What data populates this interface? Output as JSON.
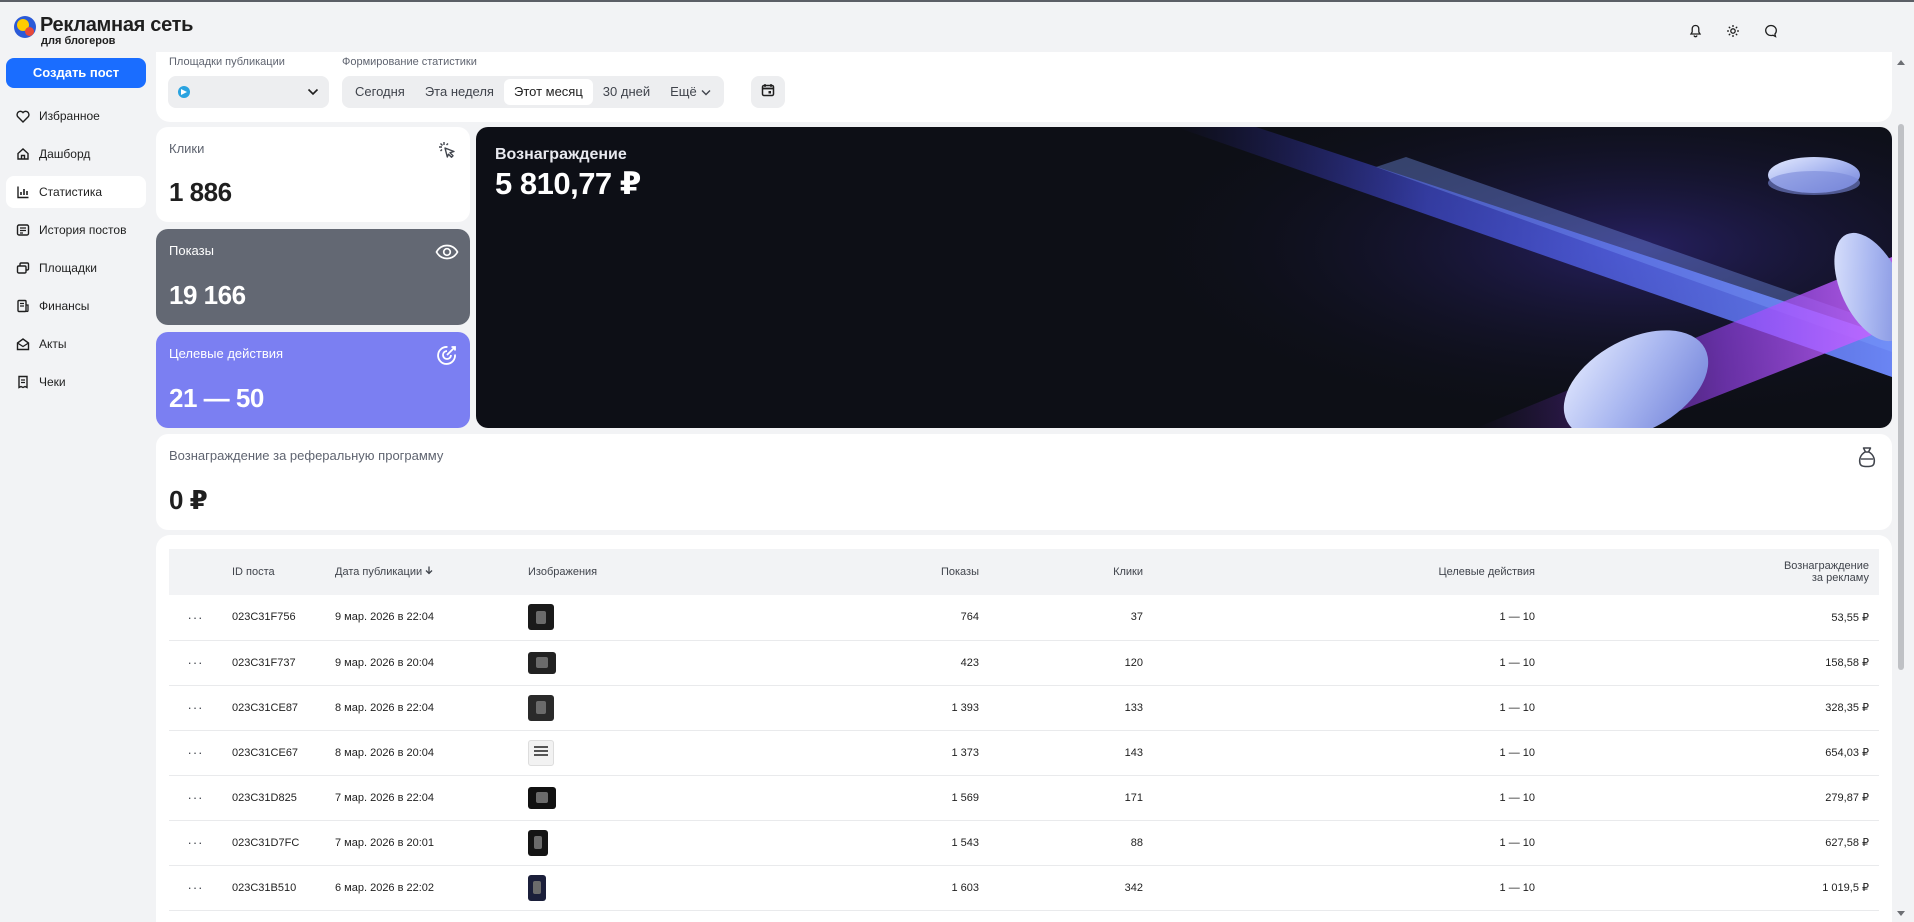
{
  "app": {
    "title": "Рекламная сеть",
    "subtitle": "для блогеров"
  },
  "header_icons": [
    "bell-icon",
    "gear-icon",
    "chat-icon"
  ],
  "sidebar": {
    "create_label": "Создать пост",
    "items": [
      {
        "label": "Избранное",
        "icon": "heart-icon"
      },
      {
        "label": "Дашборд",
        "icon": "home-icon"
      },
      {
        "label": "Статистика",
        "icon": "chart-icon",
        "active": true
      },
      {
        "label": "История постов",
        "icon": "posts-icon"
      },
      {
        "label": "Площадки",
        "icon": "platforms-icon"
      },
      {
        "label": "Финансы",
        "icon": "finance-icon"
      },
      {
        "label": "Акты",
        "icon": "acts-icon"
      },
      {
        "label": "Чеки",
        "icon": "receipt-icon"
      }
    ]
  },
  "filters": {
    "platforms_label": "Площадки публикации",
    "period_label": "Формирование статистики",
    "periods": [
      "Сегодня",
      "Эта неделя",
      "Этот месяц",
      "30 дней"
    ],
    "active_period": "Этот месяц",
    "more_label": "Ещё"
  },
  "stats": {
    "clicks_label": "Клики",
    "clicks_value": "1 886",
    "views_label": "Показы",
    "views_value": "19 166",
    "target_label": "Целевые действия",
    "target_value": "21 — 50",
    "reward_label": "Вознаграждение",
    "reward_value": "5 810,77 ₽",
    "referral_label": "Вознаграждение за реферальную программу",
    "referral_value": "0 ₽"
  },
  "colors": {
    "accent": "#1a6dff",
    "views_card": "#636873",
    "target_card": "#7b7ff2",
    "reward_card": "#0d0f16"
  },
  "table": {
    "headers": {
      "id": "ID поста",
      "date": "Дата публикации",
      "images": "Изображения",
      "views": "Показы",
      "clicks": "Клики",
      "target": "Целевые действия",
      "reward_line1": "Вознаграждение",
      "reward_line2": "за рекламу"
    },
    "rows": [
      {
        "id": "023C31F756",
        "date": "9 мар. 2026 в 22:04",
        "views": "764",
        "clicks": "37",
        "target": "1 — 10",
        "reward": "53,55 ₽"
      },
      {
        "id": "023C31F737",
        "date": "9 мар. 2026 в 20:04",
        "views": "423",
        "clicks": "120",
        "target": "1 — 10",
        "reward": "158,58 ₽"
      },
      {
        "id": "023C31CE87",
        "date": "8 мар. 2026 в 22:04",
        "views": "1 393",
        "clicks": "133",
        "target": "1 — 10",
        "reward": "328,35 ₽"
      },
      {
        "id": "023C31CE67",
        "date": "8 мар. 2026 в 20:04",
        "views": "1 373",
        "clicks": "143",
        "target": "1 — 10",
        "reward": "654,03 ₽"
      },
      {
        "id": "023C31D825",
        "date": "7 мар. 2026 в 22:04",
        "views": "1 569",
        "clicks": "171",
        "target": "1 — 10",
        "reward": "279,87 ₽"
      },
      {
        "id": "023C31D7FC",
        "date": "7 мар. 2026 в 20:01",
        "views": "1 543",
        "clicks": "88",
        "target": "1 — 10",
        "reward": "627,58 ₽"
      },
      {
        "id": "023C31B510",
        "date": "6 мар. 2026 в 22:02",
        "views": "1 603",
        "clicks": "342",
        "target": "1 — 10",
        "reward": "1 019,5 ₽"
      }
    ]
  }
}
